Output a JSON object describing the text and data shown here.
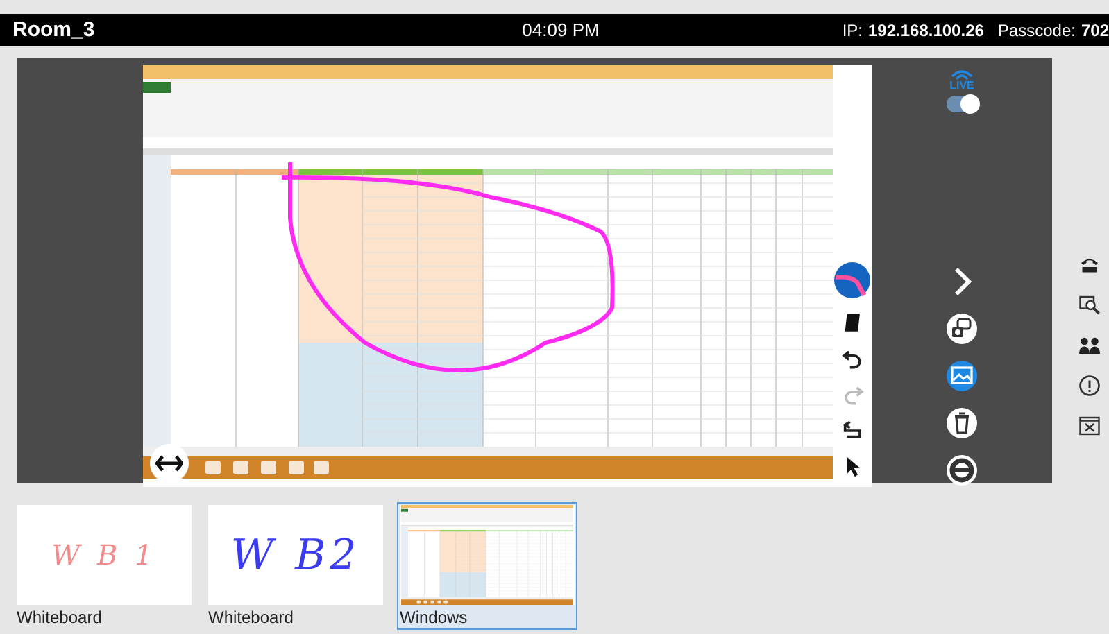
{
  "header": {
    "room": "Room_3",
    "time": "04:09 PM",
    "ip_label": "IP:",
    "ip": "192.168.100.26",
    "passcode_label": "Passcode:",
    "passcode": "702"
  },
  "live": {
    "label": "LIVE",
    "on": true
  },
  "annotation_tools": [
    {
      "kind": "pen",
      "disabled": false
    },
    {
      "kind": "eraser",
      "disabled": false
    },
    {
      "kind": "undo",
      "disabled": false
    },
    {
      "kind": "redo",
      "disabled": true
    },
    {
      "kind": "return",
      "disabled": false
    },
    {
      "kind": "pointer",
      "disabled": false
    }
  ],
  "panel_tools": [
    {
      "kind": "chevron",
      "selected": false
    },
    {
      "kind": "camera",
      "selected": false
    },
    {
      "kind": "image",
      "selected": true
    },
    {
      "kind": "trash",
      "selected": false
    },
    {
      "kind": "lifebuoy",
      "selected": false
    }
  ],
  "side_tools": [
    {
      "kind": "phone"
    },
    {
      "kind": "zoom"
    },
    {
      "kind": "people"
    },
    {
      "kind": "info"
    },
    {
      "kind": "close"
    }
  ],
  "thumbnails": [
    {
      "kind": "whiteboard",
      "label": "Whiteboard",
      "ink": "W B 1",
      "color": "#f28b8b",
      "selected": false
    },
    {
      "kind": "whiteboard",
      "label": "Whiteboard",
      "ink": "W B2",
      "color": "#3b3bf0",
      "selected": false
    },
    {
      "kind": "screen",
      "label": "Windows",
      "selected": true
    }
  ]
}
